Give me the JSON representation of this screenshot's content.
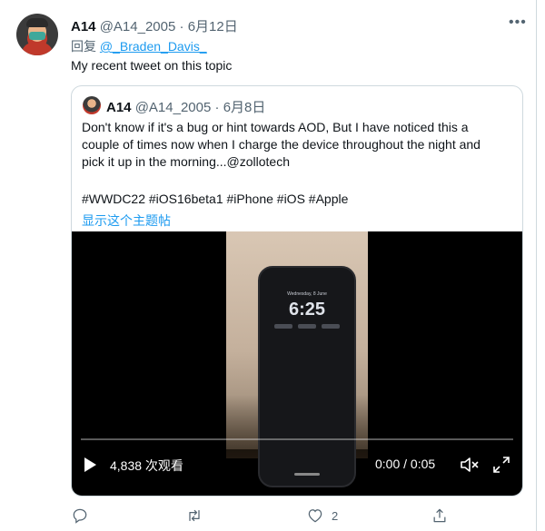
{
  "tweet": {
    "name": "A14",
    "handle": "@A14_2005",
    "separator": "·",
    "date": "6月12日",
    "reply_prefix": "回复",
    "reply_to": "@_Braden_Davis_",
    "text": "My recent tweet on this topic"
  },
  "quoted": {
    "name": "A14",
    "handle": "@A14_2005",
    "separator": "·",
    "date": "6月8日",
    "text_lines": [
      "Don't know if it's a bug or hint towards AOD, But I have noticed this a",
      "couple of times now when I charge the device throughout the night and",
      "pick it up in the morning...@zollotech"
    ],
    "hashtags": "#WWDC22  #iOS16beta1 #iPhone #iOS #Apple",
    "show_thread": "显示这个主题帖",
    "video": {
      "phone_date": "Wednesday, 8 June",
      "phone_time": "6:25",
      "views": "4,838 次观看",
      "time": "0:00 / 0:05",
      "progress": 0.0
    }
  },
  "actions": {
    "reply_count": "",
    "retweet_count": "",
    "like_count": "2"
  },
  "icons": [
    "more-icon",
    "play-icon",
    "mute-icon",
    "fullscreen-icon",
    "reply-icon",
    "retweet-icon",
    "like-icon",
    "share-icon"
  ],
  "colors": {
    "accent": "#1d9bf0",
    "secondary_text": "#536471",
    "border": "#cfd9de"
  }
}
